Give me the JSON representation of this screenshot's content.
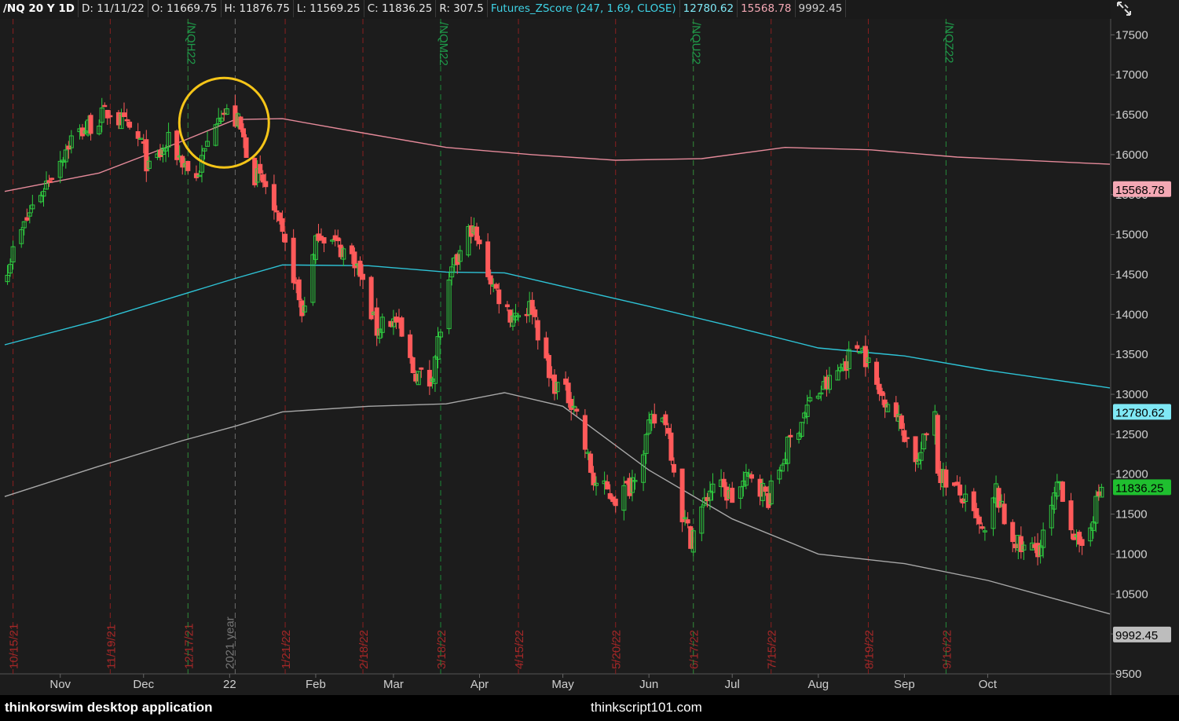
{
  "header": {
    "symbol": "/NQ 20 Y 1D",
    "date": "D: 11/11/22",
    "open": "O: 11669.75",
    "high": "H: 11876.75",
    "low": "L: 11569.25",
    "close": "C: 11836.25",
    "range": "R: 307.5",
    "study": "Futures_ZScore (247, 1.69, CLOSE)",
    "study_mid": "12780.62",
    "study_upper": "15568.78",
    "study_lower": "9992.45"
  },
  "icons": {
    "crosshair": "crosshair-arrows-icon"
  },
  "colors": {
    "background": "#1c1c1c",
    "up_candle": "#2ecc40",
    "down_candle": "#ff5a5a",
    "upper_band": "#e58a9a",
    "mid_band": "#2ec3d6",
    "lower_band": "#a8a8a8",
    "expiry_line": "#1a8a3a",
    "month_line": "#8a1f1f",
    "highlight_circle": "#f5c518"
  },
  "footer": {
    "left": "thinkorswim desktop application",
    "center": "thinkscript101.com"
  },
  "chart_data": {
    "type": "candlestick",
    "title": "/NQ 20 Y 1D",
    "ylim": [
      9500,
      17700
    ],
    "y_ticks": [
      9500,
      10000,
      10500,
      11000,
      11500,
      12000,
      12500,
      13000,
      13500,
      14000,
      14500,
      15000,
      15500,
      16000,
      16500,
      17000,
      17500
    ],
    "x_month_labels": [
      {
        "label": "Nov",
        "date": "2021-11-01"
      },
      {
        "label": "Dec",
        "date": "2021-12-01"
      },
      {
        "label": "22",
        "date": "2022-01-01"
      },
      {
        "label": "Feb",
        "date": "2022-02-01"
      },
      {
        "label": "Mar",
        "date": "2022-03-01"
      },
      {
        "label": "Apr",
        "date": "2022-04-01"
      },
      {
        "label": "May",
        "date": "2022-05-01"
      },
      {
        "label": "Jun",
        "date": "2022-06-01"
      },
      {
        "label": "Jul",
        "date": "2022-07-01"
      },
      {
        "label": "Aug",
        "date": "2022-08-01"
      },
      {
        "label": "Sep",
        "date": "2022-09-01"
      },
      {
        "label": "Oct",
        "date": "2022-10-01"
      }
    ],
    "x_range": [
      "2021-10-12",
      "2022-11-14"
    ],
    "expiry_markers": [
      {
        "label": "/NQH22",
        "date": "2021-12-17"
      },
      {
        "label": "/NQM22",
        "date": "2022-03-18"
      },
      {
        "label": "/NQU22",
        "date": "2022-06-17"
      },
      {
        "label": "/NQZ22",
        "date": "2022-09-16"
      }
    ],
    "date_markers": [
      {
        "label": "10/15/21",
        "date": "2021-10-15"
      },
      {
        "label": "11/19/21",
        "date": "2021-11-19"
      },
      {
        "label": "12/17/21",
        "date": "2021-12-17"
      },
      {
        "label": "1/21/22",
        "date": "2022-01-21"
      },
      {
        "label": "2/18/22",
        "date": "2022-02-18"
      },
      {
        "label": "3/18/22",
        "date": "2022-03-18"
      },
      {
        "label": "4/15/22",
        "date": "2022-04-15"
      },
      {
        "label": "5/20/22",
        "date": "2022-05-20"
      },
      {
        "label": "6/17/22",
        "date": "2022-06-17"
      },
      {
        "label": "7/15/22",
        "date": "2022-07-15"
      },
      {
        "label": "8/19/22",
        "date": "2022-08-19"
      },
      {
        "label": "9/16/22",
        "date": "2022-09-16"
      }
    ],
    "year_marker": {
      "label": "2021 year",
      "date": "2022-01-03"
    },
    "price_anchors": [
      [
        "2021-10-13",
        14620
      ],
      [
        "2021-10-22",
        15350
      ],
      [
        "2021-11-05",
        16200
      ],
      [
        "2021-11-19",
        16550
      ],
      [
        "2021-11-30",
        16150
      ],
      [
        "2021-12-03",
        15800
      ],
      [
        "2021-12-10",
        16150
      ],
      [
        "2021-12-20",
        15700
      ],
      [
        "2021-12-28",
        16580
      ],
      [
        "2022-01-04",
        16400
      ],
      [
        "2022-01-10",
        15750
      ],
      [
        "2022-01-14",
        15600
      ],
      [
        "2022-01-24",
        14500
      ],
      [
        "2022-01-27",
        14000
      ],
      [
        "2022-02-02",
        15050
      ],
      [
        "2022-02-09",
        14850
      ],
      [
        "2022-02-15",
        14700
      ],
      [
        "2022-02-23",
        13800
      ],
      [
        "2022-02-25",
        13950
      ],
      [
        "2022-03-02",
        13900
      ],
      [
        "2022-03-08",
        13300
      ],
      [
        "2022-03-14",
        13150
      ],
      [
        "2022-03-22",
        14500
      ],
      [
        "2022-03-29",
        15100
      ],
      [
        "2022-04-06",
        14350
      ],
      [
        "2022-04-12",
        14000
      ],
      [
        "2022-04-20",
        14100
      ],
      [
        "2022-04-26",
        13200
      ],
      [
        "2022-05-05",
        12900
      ],
      [
        "2022-05-12",
        11900
      ],
      [
        "2022-05-20",
        11700
      ],
      [
        "2022-05-25",
        11850
      ],
      [
        "2022-06-02",
        12650
      ],
      [
        "2022-06-07",
        12700
      ],
      [
        "2022-06-13",
        11500
      ],
      [
        "2022-06-16",
        11200
      ],
      [
        "2022-06-24",
        11900
      ],
      [
        "2022-07-01",
        11700
      ],
      [
        "2022-07-08",
        12000
      ],
      [
        "2022-07-14",
        11700
      ],
      [
        "2022-07-21",
        12350
      ],
      [
        "2022-07-29",
        12900
      ],
      [
        "2022-08-05",
        13150
      ],
      [
        "2022-08-16",
        13650
      ],
      [
        "2022-08-23",
        13000
      ],
      [
        "2022-08-26",
        12950
      ],
      [
        "2022-09-06",
        12150
      ],
      [
        "2022-09-12",
        12850
      ],
      [
        "2022-09-13",
        12050
      ],
      [
        "2022-09-22",
        11700
      ],
      [
        "2022-09-30",
        11200
      ],
      [
        "2022-10-04",
        11800
      ],
      [
        "2022-10-07",
        11400
      ],
      [
        "2022-10-13",
        11050
      ],
      [
        "2022-10-20",
        11100
      ],
      [
        "2022-10-27",
        11900
      ],
      [
        "2022-11-03",
        11000
      ],
      [
        "2022-11-11",
        11836
      ]
    ],
    "series": [
      {
        "name": "Futures_ZScore upper",
        "label": "15568.78",
        "values": [
          [
            "2021-10-12",
            15540
          ],
          [
            "2021-11-15",
            15770
          ],
          [
            "2021-12-15",
            16170
          ],
          [
            "2022-01-03",
            16440
          ],
          [
            "2022-01-20",
            16450
          ],
          [
            "2022-02-20",
            16260
          ],
          [
            "2022-03-20",
            16090
          ],
          [
            "2022-04-20",
            16000
          ],
          [
            "2022-05-20",
            15930
          ],
          [
            "2022-06-20",
            15950
          ],
          [
            "2022-07-20",
            16090
          ],
          [
            "2022-08-20",
            16060
          ],
          [
            "2022-09-20",
            15970
          ],
          [
            "2022-11-14",
            15880
          ]
        ]
      },
      {
        "name": "Futures_ZScore mid",
        "label": "12780.62",
        "values": [
          [
            "2021-10-12",
            13620
          ],
          [
            "2021-11-15",
            13930
          ],
          [
            "2021-12-15",
            14250
          ],
          [
            "2022-01-03",
            14450
          ],
          [
            "2022-01-20",
            14620
          ],
          [
            "2022-02-20",
            14610
          ],
          [
            "2022-03-20",
            14530
          ],
          [
            "2022-04-10",
            14520
          ],
          [
            "2022-05-01",
            14350
          ],
          [
            "2022-06-01",
            14100
          ],
          [
            "2022-07-01",
            13850
          ],
          [
            "2022-08-01",
            13580
          ],
          [
            "2022-09-01",
            13480
          ],
          [
            "2022-10-01",
            13300
          ],
          [
            "2022-11-14",
            13080
          ]
        ]
      },
      {
        "name": "Futures_ZScore lower",
        "label": "9992.45",
        "values": [
          [
            "2021-10-12",
            11720
          ],
          [
            "2021-11-15",
            12100
          ],
          [
            "2021-12-15",
            12420
          ],
          [
            "2022-01-03",
            12600
          ],
          [
            "2022-01-20",
            12780
          ],
          [
            "2022-02-20",
            12850
          ],
          [
            "2022-03-20",
            12880
          ],
          [
            "2022-04-10",
            13020
          ],
          [
            "2022-05-01",
            12850
          ],
          [
            "2022-06-01",
            12050
          ],
          [
            "2022-07-01",
            11440
          ],
          [
            "2022-08-01",
            11000
          ],
          [
            "2022-09-01",
            10880
          ],
          [
            "2022-10-01",
            10670
          ],
          [
            "2022-11-14",
            10250
          ]
        ]
      }
    ],
    "price_labels": [
      {
        "value": 15568.78,
        "text": "15568.78",
        "color": "#f4a8b4"
      },
      {
        "value": 12780.62,
        "text": "12780.62",
        "color": "#7fe8f5"
      },
      {
        "value": 11836.25,
        "text": "11836.25",
        "color": "#1fbf2f"
      },
      {
        "value": 9992.45,
        "text": "9992.45",
        "color": "#bdbdbd"
      }
    ],
    "annotation": {
      "type": "circle",
      "center_date": "2021-12-30",
      "center_value": 16400
    }
  }
}
